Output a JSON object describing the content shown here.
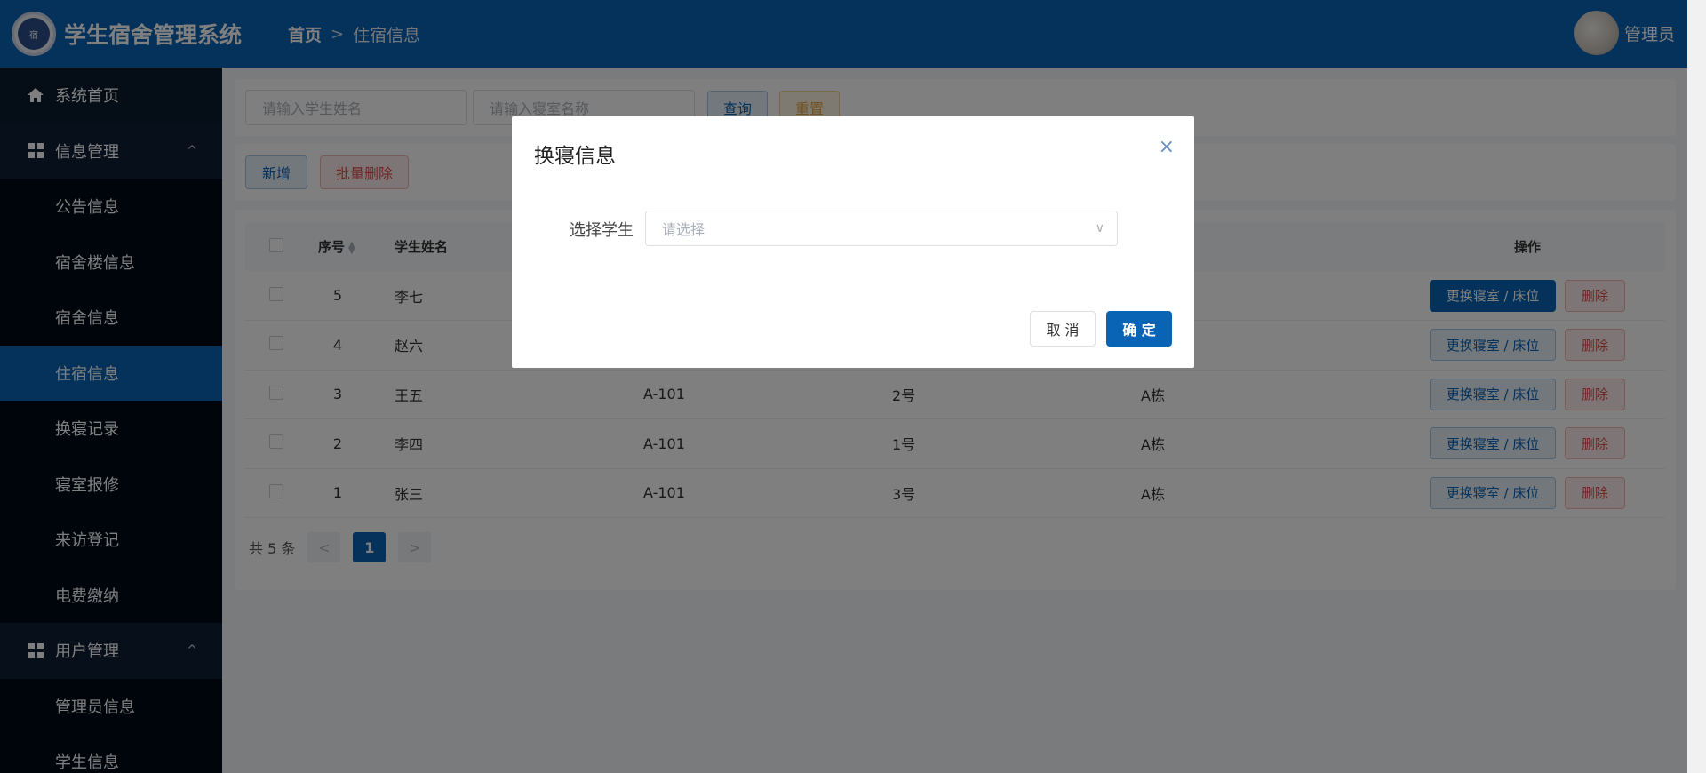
{
  "header": {
    "logo_text": "宿",
    "title": "学生宿舍管理系统",
    "breadcrumb": {
      "home": "首页",
      "separator": ">",
      "current": "住宿信息"
    },
    "user": {
      "name": "管理员"
    }
  },
  "sidebar": {
    "home": "系统首页",
    "info_group": "信息管理",
    "info_items": [
      "公告信息",
      "宿舍楼信息",
      "宿舍信息",
      "住宿信息",
      "换寝记录",
      "寝室报修",
      "来访登记",
      "电费缴纳"
    ],
    "user_group": "用户管理",
    "user_items": [
      "管理员信息",
      "学生信息"
    ],
    "active": "住宿信息",
    "group_arrow": "^"
  },
  "search": {
    "student_placeholder": "请输入学生姓名",
    "room_placeholder": "请输入寝室名称",
    "query": "查询",
    "reset": "重置"
  },
  "actions": {
    "add": "新增",
    "batch_delete": "批量删除"
  },
  "table": {
    "headers": {
      "no": "序号",
      "name": "学生姓名",
      "room": "",
      "bed": "",
      "building": "",
      "ops": "操作"
    },
    "rows": [
      {
        "no": "5",
        "name": "李七",
        "room": "",
        "bed": "",
        "building": ""
      },
      {
        "no": "4",
        "name": "赵六",
        "room": "",
        "bed": "",
        "building": ""
      },
      {
        "no": "3",
        "name": "王五",
        "room": "A-101",
        "bed": "2号",
        "building": "A栋"
      },
      {
        "no": "2",
        "name": "李四",
        "room": "A-101",
        "bed": "1号",
        "building": "A栋"
      },
      {
        "no": "1",
        "name": "张三",
        "room": "A-101",
        "bed": "3号",
        "building": "A栋"
      }
    ],
    "change_label": "更换寝室 / 床位",
    "delete_label": "删除"
  },
  "pagination": {
    "total": "共 5 条",
    "prev": "<",
    "current": "1",
    "next": ">"
  },
  "dialog": {
    "title": "换寝信息",
    "close": "×",
    "label": "选择学生",
    "placeholder": "请选择",
    "chevron": "∨",
    "cancel": "取 消",
    "confirm": "确 定"
  }
}
